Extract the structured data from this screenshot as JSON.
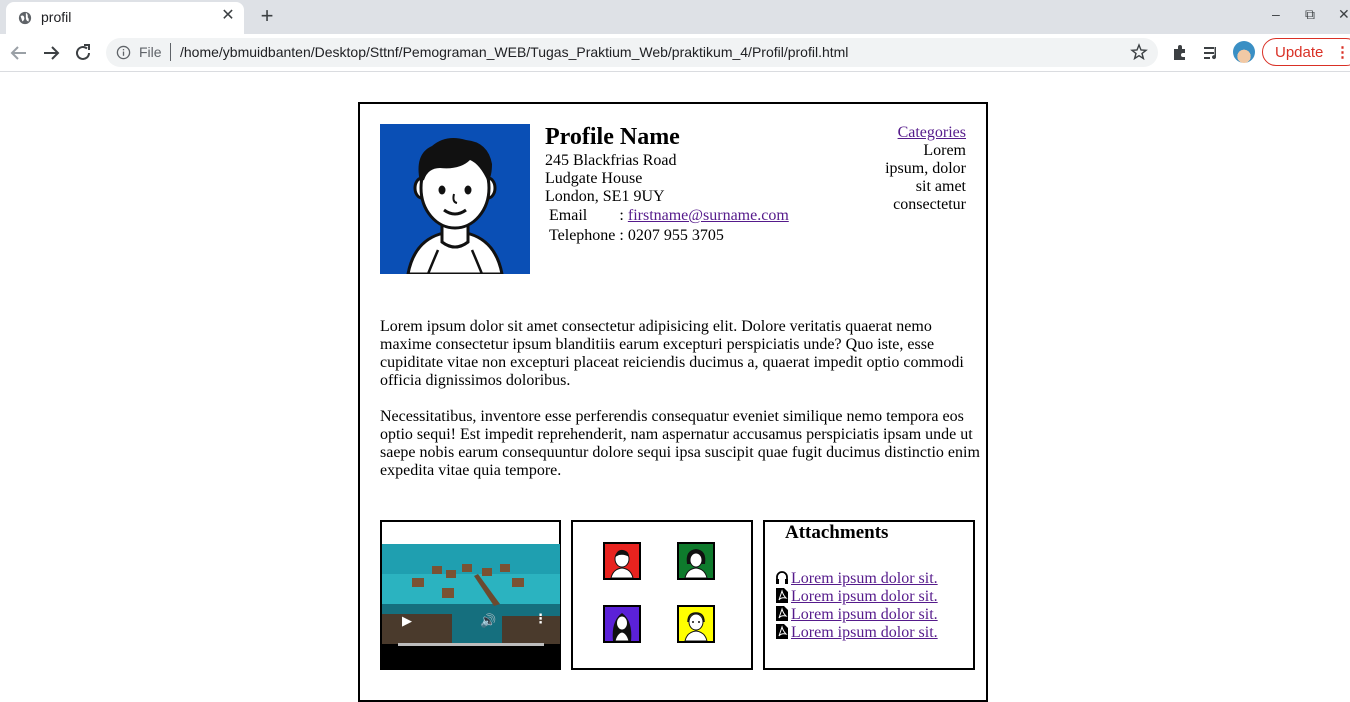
{
  "browser": {
    "tab_title": "profil",
    "url_scheme": "File",
    "url": "/home/ybmuidbanten/Desktop/Sttnf/Pemograman_WEB/Tugas_Praktium_Web/praktikum_4/Profil/profil.html",
    "update_label": "Update",
    "update_menu": "⋮",
    "tab_close": "✕",
    "new_tab": "+",
    "minimize": "–",
    "restore": "⧉",
    "close": "✕"
  },
  "profile": {
    "name": "Profile Name",
    "address": [
      "245 Blackfrias Road",
      "Ludgate House",
      "London, SE1 9UY"
    ],
    "email_label": "Email",
    "email_sep": ":",
    "email": "firstname@surname.com",
    "phone_label": "Telephone",
    "phone_sep": ":",
    "phone": "0207 955 3705",
    "photo_bg": "#0a4fb5"
  },
  "categories": {
    "link": "Categories",
    "lines": [
      "Lorem",
      "ipsum, dolor",
      "sit amet",
      "consectetur"
    ]
  },
  "paragraphs": [
    "Lorem ipsum dolor sit amet consectetur adipisicing elit. Dolore veritatis quaerat nemo maxime consectetur ipsum blanditiis earum excepturi perspiciatis unde? Quo iste, esse cupiditate vitae non excepturi placeat reiciendis ducimus a, quaerat impedit optio commodi officia dignissimos doloribus.",
    "Necessitatibus, inventore esse perferendis consequatur eveniet similique nemo tempora eos optio sequi! Est impedit reprehenderit, nam aspernatur accusamus perspiciatis ipsam unde ut saepe nobis earum consequuntur dolore sequi ipsa suscipit quae fugit ducimus distinctio enim expedita vitae quia tempore."
  ],
  "gallery": {
    "colors": [
      "#e8231f",
      "#0e7a2c",
      "#5b21d8",
      "#ffff00"
    ]
  },
  "attachments": {
    "title": "Attachments",
    "items": [
      {
        "icon": "headphones-icon",
        "label": "Lorem ipsum dolor sit."
      },
      {
        "icon": "pdf-icon",
        "label": "Lorem ipsum dolor sit."
      },
      {
        "icon": "pdf-icon",
        "label": "Lorem ipsum dolor sit."
      },
      {
        "icon": "pdf-icon",
        "label": "Lorem ipsum dolor sit."
      }
    ]
  }
}
